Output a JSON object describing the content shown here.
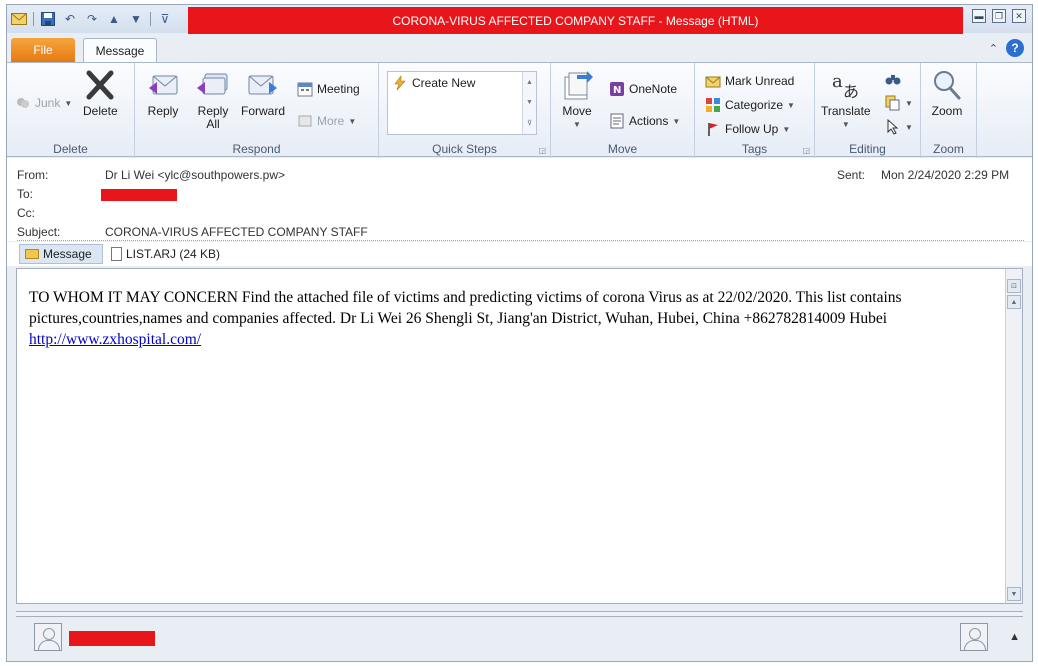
{
  "window": {
    "title": "CORONA-VIRUS AFFECTED COMPANY STAFF  -  Message (HTML)",
    "title_bar_color": "#e8161b"
  },
  "tabs": {
    "file": "File",
    "message": "Message"
  },
  "ribbon": {
    "delete": {
      "junk": "Junk",
      "delete": "Delete",
      "label": "Delete"
    },
    "respond": {
      "reply": "Reply",
      "reply_all_1": "Reply",
      "reply_all_2": "All",
      "forward": "Forward",
      "meeting": "Meeting",
      "more": "More",
      "label": "Respond"
    },
    "quick_steps": {
      "create_new": "Create New",
      "label": "Quick Steps"
    },
    "move": {
      "move": "Move",
      "onenote": "OneNote",
      "actions": "Actions",
      "label": "Move"
    },
    "tags": {
      "mark_unread": "Mark Unread",
      "categorize": "Categorize",
      "follow_up": "Follow Up",
      "label": "Tags"
    },
    "editing": {
      "translate": "Translate",
      "label": "Editing"
    },
    "zoom": {
      "zoom": "Zoom",
      "label": "Zoom"
    }
  },
  "header": {
    "from_label": "From:",
    "from_value": "Dr Li Wei <ylc@southpowers.pw>",
    "to_label": "To:",
    "cc_label": "Cc:",
    "subject_label": "Subject:",
    "subject_value": "CORONA-VIRUS AFFECTED COMPANY STAFF",
    "sent_label": "Sent:",
    "sent_value": "Mon 2/24/2020 2:29 PM"
  },
  "attachments": {
    "message_tab": "Message",
    "file": "LIST.ARJ (24 KB)"
  },
  "body": {
    "text": "TO WHOM IT MAY CONCERN Find the attached file of victims and predicting victims of corona Virus as at 22/02/2020. This list contains pictures,countries,names and companies affected. Dr Li Wei 26 Shengli St, Jiang'an District, Wuhan, Hubei, China +862782814009 Hubei ",
    "link": "http://www.zxhospital.com/"
  },
  "colors": {
    "redaction": "#e8161b",
    "file_tab": "#e67a12",
    "link": "#0000cc"
  }
}
